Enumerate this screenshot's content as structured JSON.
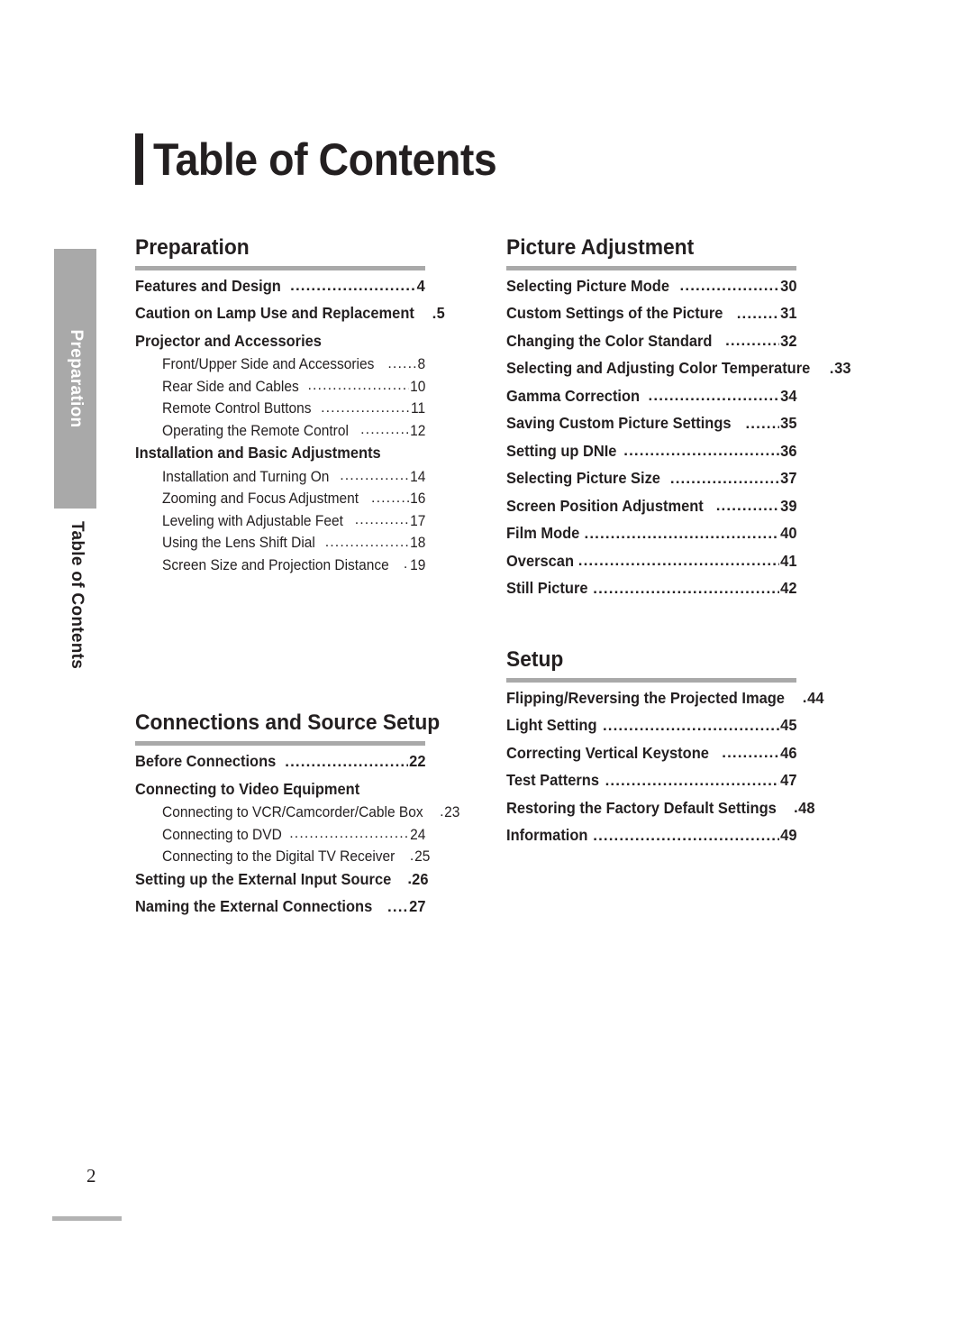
{
  "page": {
    "title": "Table of Contents",
    "number": "2",
    "accent_gray": "#a9a9a9",
    "text_color": "#231f20"
  },
  "sidebar": {
    "tab_label": "Preparation",
    "section_label": "Table of Contents"
  },
  "leader": "..............................................................................................",
  "columns": {
    "left": [
      {
        "title": "Preparation",
        "entries": [
          {
            "level": "major",
            "text": "Features and Design",
            "page": "4"
          },
          {
            "level": "major",
            "text": "Caution on Lamp Use and Replacement",
            "page": "5"
          },
          {
            "level": "group",
            "text": "Projector and Accessories",
            "page": ""
          },
          {
            "level": "sub",
            "text": "Front/Upper Side and Accessories",
            "page": "8"
          },
          {
            "level": "sub",
            "text": "Rear Side and Cables",
            "page": "10"
          },
          {
            "level": "sub",
            "text": "Remote Control Buttons",
            "page": "11"
          },
          {
            "level": "sub",
            "text": "Operating the Remote Control",
            "page": "12"
          },
          {
            "level": "group",
            "text": "Installation and Basic Adjustments",
            "page": ""
          },
          {
            "level": "sub",
            "text": "Installation and Turning On",
            "page": "14"
          },
          {
            "level": "sub",
            "text": "Zooming and Focus Adjustment",
            "page": "16"
          },
          {
            "level": "sub",
            "text": "Leveling with Adjustable Feet",
            "page": "17"
          },
          {
            "level": "sub",
            "text": "Using the Lens Shift Dial",
            "page": "18"
          },
          {
            "level": "sub",
            "text": "Screen Size and Projection Distance",
            "page": "19"
          }
        ]
      },
      {
        "title": "Connections and Source Setup",
        "entries": [
          {
            "level": "major",
            "text": "Before Connections",
            "page": "22"
          },
          {
            "level": "group",
            "text": "Connecting to Video Equipment",
            "page": ""
          },
          {
            "level": "sub",
            "text": "Connecting to VCR/Camcorder/Cable Box",
            "page": "23"
          },
          {
            "level": "sub",
            "text": "Connecting to DVD",
            "page": "24"
          },
          {
            "level": "sub",
            "text": "Connecting to the Digital TV Receiver",
            "page": "25"
          },
          {
            "level": "major",
            "text": "Setting up the External Input Source",
            "page": "26"
          },
          {
            "level": "major",
            "text": "Naming the External Connections",
            "page": "27"
          }
        ]
      }
    ],
    "right": [
      {
        "title": "Picture Adjustment",
        "entries": [
          {
            "level": "major",
            "text": "Selecting Picture Mode",
            "page": "30"
          },
          {
            "level": "major",
            "text": "Custom Settings of the Picture",
            "page": "31"
          },
          {
            "level": "major",
            "text": "Changing the Color Standard",
            "page": "32"
          },
          {
            "level": "major",
            "text": "Selecting and Adjusting Color Temperature",
            "page": "33"
          },
          {
            "level": "major",
            "text": "Gamma Correction",
            "page": "34"
          },
          {
            "level": "major",
            "text": "Saving Custom Picture Settings",
            "page": "35"
          },
          {
            "level": "major",
            "text": "Setting up DNIe",
            "page": "36"
          },
          {
            "level": "major",
            "text": "Selecting Picture Size",
            "page": "37"
          },
          {
            "level": "major",
            "text": "Screen Position Adjustment",
            "page": "39"
          },
          {
            "level": "major",
            "text": "Film Mode",
            "page": "40"
          },
          {
            "level": "major",
            "text": "Overscan",
            "page": "41"
          },
          {
            "level": "major",
            "text": "Still Picture",
            "page": "42"
          }
        ]
      },
      {
        "title": "Setup",
        "entries": [
          {
            "level": "major",
            "text": "Flipping/Reversing the Projected Image",
            "page": "44"
          },
          {
            "level": "major",
            "text": "Light Setting",
            "page": "45"
          },
          {
            "level": "major",
            "text": "Correcting Vertical Keystone",
            "page": "46"
          },
          {
            "level": "major",
            "text": "Test Patterns",
            "page": "47"
          },
          {
            "level": "major",
            "text": "Restoring the Factory Default Settings",
            "page": "48"
          },
          {
            "level": "major",
            "text": "Information",
            "page": "49"
          }
        ]
      }
    ]
  }
}
